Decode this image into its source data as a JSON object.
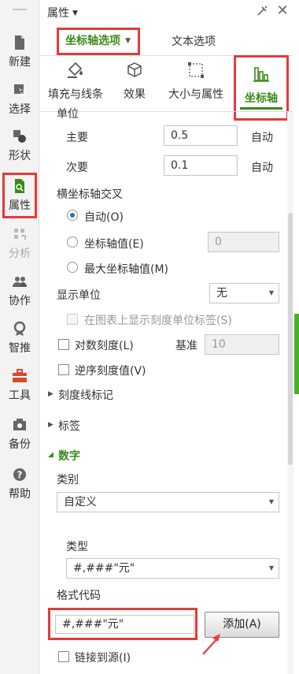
{
  "header": {
    "title": "属性"
  },
  "rail": {
    "items": [
      {
        "label": "新建",
        "icon": "new-doc-icon"
      },
      {
        "label": "选择",
        "icon": "select-cursor-icon"
      },
      {
        "label": "形状",
        "icon": "shapes-icon"
      },
      {
        "label": "属性",
        "icon": "properties-icon",
        "active": true
      },
      {
        "label": "分析",
        "icon": "analysis-icon",
        "disabled": true
      },
      {
        "label": "协作",
        "icon": "collaborate-icon"
      },
      {
        "label": "智推",
        "icon": "smart-recommend-icon"
      },
      {
        "label": "工具",
        "icon": "toolbox-icon"
      },
      {
        "label": "备份",
        "icon": "backup-icon"
      },
      {
        "label": "帮助",
        "icon": "help-icon"
      }
    ]
  },
  "tabs": {
    "axis_options": "坐标轴选项",
    "text_options": "文本选项"
  },
  "icon_tabs": [
    {
      "label": "填充与线条",
      "icon": "fill-bucket-icon"
    },
    {
      "label": "效果",
      "icon": "effect-cube-icon"
    },
    {
      "label": "大小与属性",
      "icon": "size-frame-icon"
    },
    {
      "label": "坐标轴",
      "icon": "axis-bars-icon",
      "active": true
    }
  ],
  "units": {
    "heading": "单位",
    "major_label": "主要",
    "major_value": "0.5",
    "major_auto": "自动",
    "minor_label": "次要",
    "minor_value": "0.1",
    "minor_auto": "自动"
  },
  "cross": {
    "heading": "横坐标轴交叉",
    "auto": "自动(O)",
    "axis_value": "坐标轴值(E)",
    "axis_value_input": "0",
    "max_value": "最大坐标轴值(M)"
  },
  "display_unit": {
    "label": "显示单位",
    "value": "无",
    "show_label_checkbox": "在图表上显示刻度单位标签(S)"
  },
  "log": {
    "label": "对数刻度(L)",
    "base_label": "基准",
    "base_value": "10"
  },
  "reverse": {
    "label": "逆序刻度值(V)"
  },
  "sections": {
    "tick_marks": "刻度线标记",
    "labels": "标签",
    "number": "数字"
  },
  "number": {
    "category_label": "类别",
    "category_value": "自定义",
    "type_label": "类型",
    "type_value": "#,###\"元\"",
    "format_code_label": "格式代码",
    "format_code_value": "#,###\"元\"",
    "add_button": "添加(A)",
    "link_to_source": "链接到源(I)"
  },
  "colors": {
    "accent_green": "#3a8a1a",
    "highlight_red": "#e23b3b",
    "radio_blue": "#2b6cc4"
  }
}
